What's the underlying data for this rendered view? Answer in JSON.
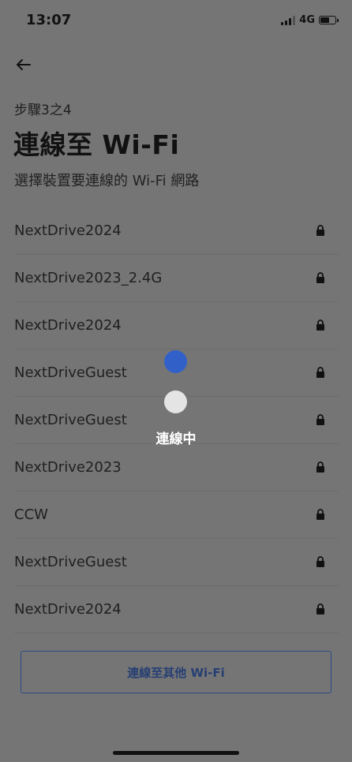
{
  "status_bar": {
    "time": "13:07",
    "network": "4G",
    "battery_level": 0.7,
    "signal_bars": 3
  },
  "header": {
    "step": "步驟3之4",
    "title": "連線至 Wi-Fi",
    "subtitle": "選擇裝置要連線的 Wi-Fi 網路"
  },
  "networks": [
    {
      "ssid": "NextDrive2024",
      "icon": "lock-icon"
    },
    {
      "ssid": "NextDrive2023_2.4G",
      "icon": "lock-icon"
    },
    {
      "ssid": "NextDrive2024",
      "icon": "lock-icon"
    },
    {
      "ssid": "NextDriveGuest",
      "icon": "lock-icon"
    },
    {
      "ssid": "NextDriveGuest",
      "icon": "lock-icon"
    },
    {
      "ssid": "NextDrive2023",
      "icon": "lock-icon"
    },
    {
      "ssid": "CCW",
      "icon": "lock-icon"
    },
    {
      "ssid": "NextDriveGuest",
      "icon": "lock-icon"
    },
    {
      "ssid": "NextDrive2024",
      "icon": "lock-icon"
    }
  ],
  "loading": {
    "label": "連線中"
  },
  "other_button": {
    "label": "連線至其他 Wi-Fi"
  },
  "colors": {
    "overlay": "#757575",
    "accent": "#3161c8",
    "button_border": "#2d4a85"
  }
}
